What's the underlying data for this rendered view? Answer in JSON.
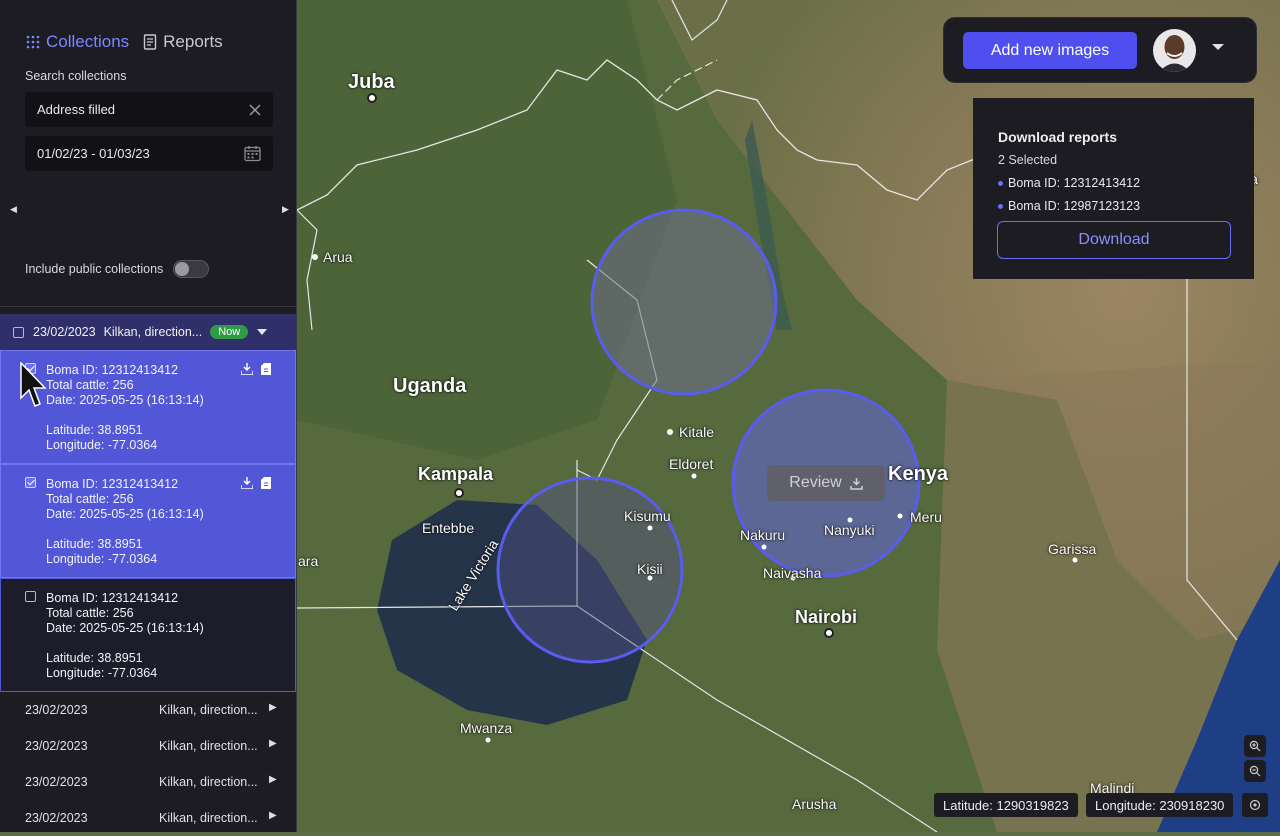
{
  "nav": {
    "collections_label": "Collections",
    "reports_label": "Reports"
  },
  "search": {
    "label": "Search collections",
    "address_value": "Address filled",
    "date_value": "01/02/23 - 01/03/23"
  },
  "toggle": {
    "label": "Include public collections",
    "on": false
  },
  "group": {
    "date": "23/02/2023",
    "location": "Kilkan, direction...",
    "badge": "Now"
  },
  "cards": [
    {
      "boma": "Boma ID: 12312413412",
      "cattle": "Total cattle: 256",
      "date": "Date: 2025-05-25 (16:13:14)",
      "lat": "Latitude: 38.8951",
      "lon": "Longitude: -77.0364",
      "checked": true
    },
    {
      "boma": "Boma ID: 12312413412",
      "cattle": "Total cattle: 256",
      "date": "Date: 2025-05-25 (16:13:14)",
      "lat": "Latitude: 38.8951",
      "lon": "Longitude: -77.0364",
      "checked": true
    },
    {
      "boma": "Boma ID: 12312413412",
      "cattle": "Total cattle: 256",
      "date": "Date: 2025-05-25 (16:13:14)",
      "lat": "Latitude: 38.8951",
      "lon": "Longitude: -77.0364",
      "checked": false
    }
  ],
  "rows": [
    {
      "date": "23/02/2023",
      "location": "Kilkan, direction..."
    },
    {
      "date": "23/02/2023",
      "location": "Kilkan, direction..."
    },
    {
      "date": "23/02/2023",
      "location": "Kilkan, direction..."
    },
    {
      "date": "23/02/2023",
      "location": "Kilkan, direction..."
    }
  ],
  "topbar": {
    "add_label": "Add new images"
  },
  "download_panel": {
    "title": "Download reports",
    "selected": "2 Selected",
    "items": [
      "Boma ID: 12312413412",
      "Boma ID: 12987123123"
    ],
    "button": "Download"
  },
  "map": {
    "review_label": "Review",
    "cities": {
      "juba": "Juba",
      "arua": "Arua",
      "uganda": "Uganda",
      "kampala": "Kampala",
      "entebbe": "Entebbe",
      "kitale": "Kitale",
      "eldoret": "Eldoret",
      "kisumu": "Kisumu",
      "kisii": "Kisii",
      "kenya": "Kenya",
      "nakuru": "Nakuru",
      "nanyuki": "Nanyuki",
      "meru": "Meru",
      "naivasha": "Naivasha",
      "nairobi": "Nairobi",
      "garissa": "Garissa",
      "mwanza": "Mwanza",
      "arusha": "Arusha",
      "malindi": "Malindi",
      "lake_victoria": "Lake Victoria",
      "edge_ara": "ara",
      "edge_la": "la"
    },
    "latitude": "Latitude: 1290319823",
    "longitude": "Longitude: 230918230"
  },
  "colors": {
    "accent": "#4f4ff0",
    "selected_card": "#5257d8",
    "circle": "#5a5cf0",
    "badge_green": "#2f9a48"
  }
}
